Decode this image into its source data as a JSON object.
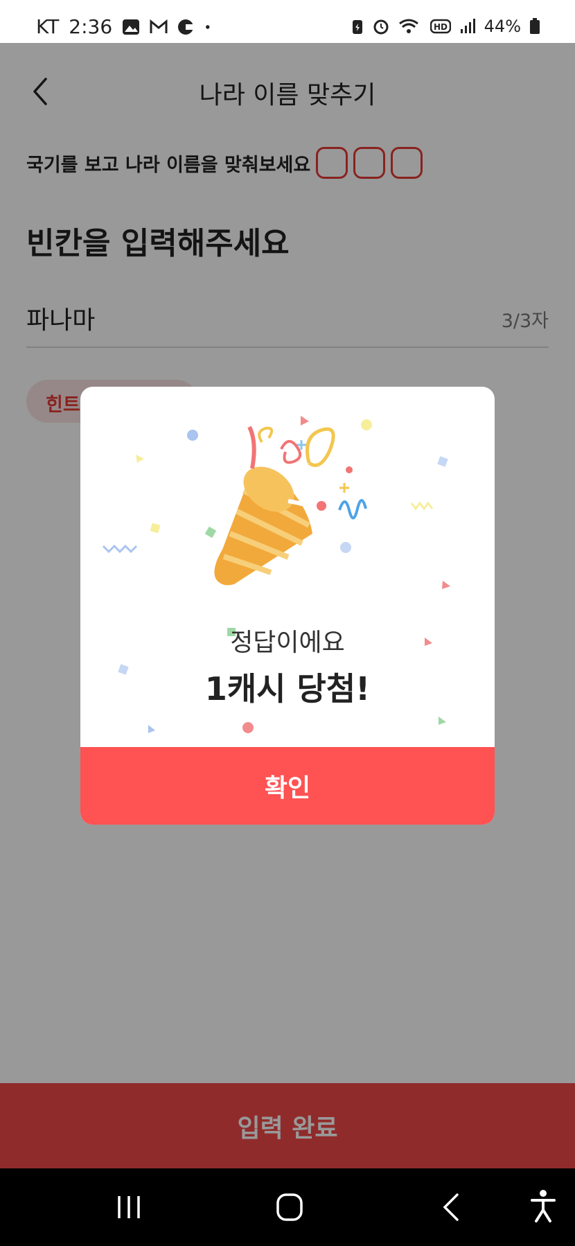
{
  "status_bar": {
    "carrier": "KT",
    "time": "2:36",
    "battery": "44%",
    "icons_left": [
      "gallery-icon",
      "gmail-icon",
      "app-icon",
      "dot-icon"
    ],
    "icons_right": [
      "battery-saver-icon",
      "alarm-icon",
      "wifi-icon",
      "hd-icon",
      "signal-icon",
      "battery-icon"
    ]
  },
  "header": {
    "title": "나라 이름 맞추기"
  },
  "quiz": {
    "instruction": "국기를 보고 나라 이름을 맞춰보세요",
    "blank_count": 3,
    "heading": "빈칸을 입력해주세요",
    "answer_value": "파나마",
    "char_count": "3/3자",
    "hint_label": "힌트"
  },
  "modal": {
    "subtitle": "정답이에요",
    "title": "1캐시 당첨!",
    "confirm_label": "확인"
  },
  "bottom_button": {
    "label": "입력 완료"
  },
  "colors": {
    "accent": "#ff5252",
    "submit": "#f04848",
    "overlay": "rgba(0,0,0,0.40)"
  }
}
